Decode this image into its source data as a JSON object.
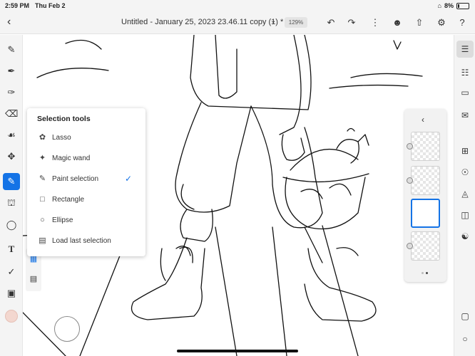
{
  "status": {
    "time": "2:59 PM",
    "date": "Thu Feb 2",
    "battery": "8%"
  },
  "header": {
    "title": "Untitled - January 25, 2023 23.46.11 copy (1) *",
    "zoom": "129%"
  },
  "selection_menu": {
    "title": "Selection tools",
    "items": [
      {
        "label": "Lasso",
        "icon": "lasso-icon"
      },
      {
        "label": "Magic wand",
        "icon": "magic-wand-icon"
      },
      {
        "label": "Paint selection",
        "icon": "paint-selection-icon",
        "selected": true
      },
      {
        "label": "Rectangle",
        "icon": "rectangle-selection-icon"
      },
      {
        "label": "Ellipse",
        "icon": "ellipse-selection-icon"
      },
      {
        "label": "Load last selection",
        "icon": "load-selection-icon"
      }
    ]
  },
  "colors": {
    "accent": "#1473e6",
    "toolbar_bg": "#f4f4f4",
    "swatch": "#f3d7cf"
  }
}
